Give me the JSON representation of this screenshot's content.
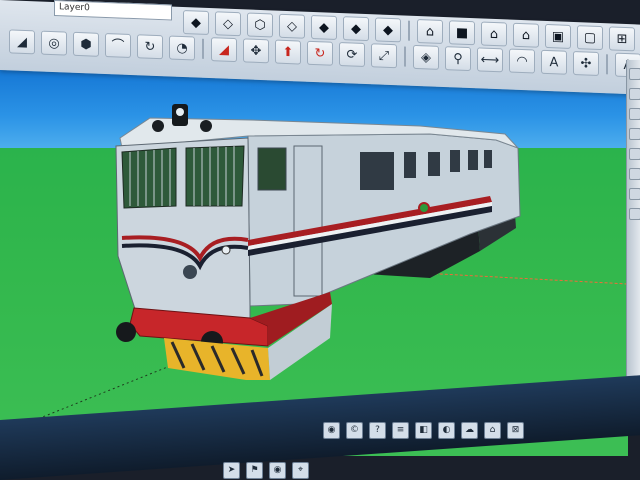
{
  "app": {
    "layer_field_value": "Layer0"
  },
  "toolbar": {
    "row1": [
      {
        "name": "xray-icon",
        "glyph": "◆"
      },
      {
        "name": "back-edges-icon",
        "glyph": "◇"
      },
      {
        "name": "wireframe-icon",
        "glyph": "⬡"
      },
      {
        "name": "hidden-line-icon",
        "glyph": "◇"
      },
      {
        "name": "shaded-icon",
        "glyph": "◆"
      },
      {
        "name": "shaded-texture-icon",
        "glyph": "◆"
      },
      {
        "name": "monochrome-icon",
        "glyph": "◆"
      },
      {
        "name": "iso-view-icon",
        "glyph": "⌂"
      },
      {
        "name": "top-view-icon",
        "glyph": "■"
      },
      {
        "name": "front-view-icon",
        "glyph": "⌂"
      },
      {
        "name": "right-view-icon",
        "glyph": "⌂"
      },
      {
        "name": "back-view-icon",
        "glyph": "▣"
      },
      {
        "name": "left-view-icon",
        "glyph": "▢"
      },
      {
        "name": "components-icon",
        "glyph": "⊞"
      },
      {
        "name": "styles-icon",
        "glyph": "⊕"
      },
      {
        "name": "save-icon",
        "glyph": "▤"
      },
      {
        "name": "cut-icon",
        "glyph": "✂"
      },
      {
        "name": "copy-icon",
        "glyph": "⧉"
      },
      {
        "name": "erase-icon",
        "glyph": "⊗"
      },
      {
        "name": "undo-icon",
        "glyph": "↶"
      },
      {
        "name": "redo-icon",
        "glyph": "↷"
      }
    ],
    "row2": [
      {
        "name": "rectangle-icon",
        "glyph": "◢"
      },
      {
        "name": "circle-icon",
        "glyph": "◎"
      },
      {
        "name": "polygon-icon",
        "glyph": "⬢"
      },
      {
        "name": "arc-icon",
        "glyph": "⌒"
      },
      {
        "name": "freehand-icon",
        "glyph": "↻"
      },
      {
        "name": "pie-icon",
        "glyph": "◔"
      },
      {
        "name": "paint-icon",
        "glyph": "◢"
      },
      {
        "name": "move-icon",
        "glyph": "✥"
      },
      {
        "name": "pushpull-icon",
        "glyph": "⬆"
      },
      {
        "name": "rotate-icon",
        "glyph": "↻"
      },
      {
        "name": "followme-icon",
        "glyph": "⟳"
      },
      {
        "name": "scale-icon",
        "glyph": "⤢"
      },
      {
        "name": "offset-icon",
        "glyph": "◈"
      },
      {
        "name": "tape-icon",
        "glyph": "⚲"
      },
      {
        "name": "dimension-icon",
        "glyph": "⟷"
      },
      {
        "name": "protractor-icon",
        "glyph": "◠"
      },
      {
        "name": "text-icon",
        "glyph": "A"
      },
      {
        "name": "axes-icon",
        "glyph": "✣"
      },
      {
        "name": "3dtext-icon",
        "glyph": "A"
      },
      {
        "name": "orbit-icon",
        "glyph": "⟲"
      },
      {
        "name": "pan-icon",
        "glyph": "✋"
      },
      {
        "name": "zoom-icon",
        "glyph": "⚲"
      },
      {
        "name": "zoom-window-icon",
        "glyph": "⚲"
      },
      {
        "name": "zoom-extents-icon",
        "glyph": "⛶"
      }
    ]
  },
  "statusbar": {
    "icons": [
      {
        "name": "geo-location-icon",
        "glyph": "◉"
      },
      {
        "name": "credits-icon",
        "glyph": "©"
      },
      {
        "name": "instructor-icon",
        "glyph": "?"
      },
      {
        "name": "layers-icon",
        "glyph": "≡"
      },
      {
        "name": "sections-icon",
        "glyph": "◧"
      },
      {
        "name": "shadows-icon",
        "glyph": "◐"
      },
      {
        "name": "fog-icon",
        "glyph": "☁"
      },
      {
        "name": "warehouse-icon",
        "glyph": "⌂"
      },
      {
        "name": "extension-icon",
        "glyph": "⊠"
      }
    ],
    "icons2": [
      {
        "name": "select-tool-icon",
        "glyph": "➤"
      },
      {
        "name": "walk-icon",
        "glyph": "⚑"
      },
      {
        "name": "lookaround-icon",
        "glyph": "◉"
      },
      {
        "name": "position-camera-icon",
        "glyph": "⌖"
      }
    ]
  },
  "colors": {
    "sky_top": "#0f6fd0",
    "ground": "#33b84d",
    "loco_body": "#c9d4dc",
    "loco_roof": "#dfe6ea",
    "stripe_red": "#a81e22",
    "stripe_dark": "#1a2030",
    "frame_red": "#c7262a",
    "pilot_yellow": "#e8b42a",
    "undercarriage": "#202428"
  }
}
